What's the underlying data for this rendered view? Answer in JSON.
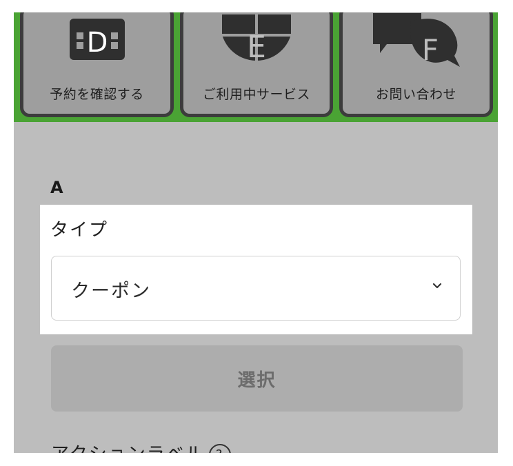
{
  "tiles": [
    {
      "label": "予約を確認する",
      "icon": "reservation-icon",
      "icon_letter": "D"
    },
    {
      "label": "ご利用中サービス",
      "icon": "globe-icon",
      "icon_letter": "E"
    },
    {
      "label": "お問い合わせ",
      "icon": "chat-bubbles-icon",
      "icon_letter": "F"
    }
  ],
  "section": {
    "label": "A"
  },
  "type_field": {
    "title": "タイプ",
    "value": "クーポン"
  },
  "select_button": {
    "label": "選択"
  },
  "action_label": {
    "text": "アクションラベル",
    "help_icon": "?"
  },
  "colors": {
    "accent_green": "#4aa334",
    "background_gray": "#bdbdbd",
    "tile_gray": "#9e9e9e"
  }
}
